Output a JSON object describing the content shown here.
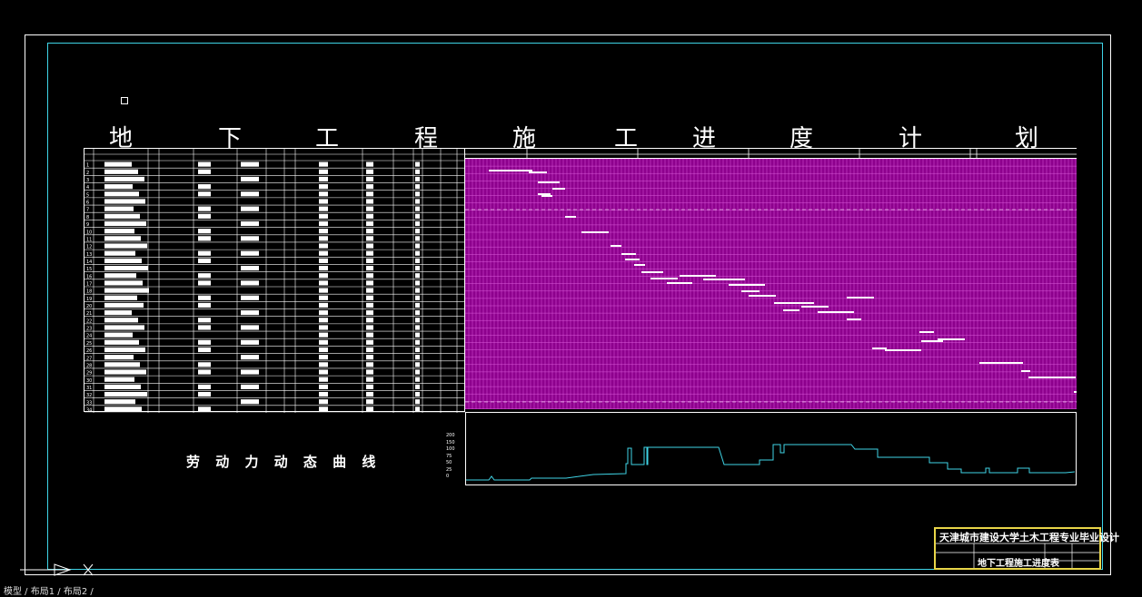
{
  "drawing": {
    "title_chars": [
      "地",
      "下",
      "工",
      "程",
      "施",
      "工",
      "进",
      "度",
      "计",
      "划"
    ],
    "labor_curve_label": "劳 动 力 动 态 曲 线",
    "title_block": {
      "school": "天津城市建设大学土木工程专业毕业设计",
      "drawing_name": "地下工程施工进度表"
    },
    "row_numbers": [
      "1",
      "2",
      "3",
      "4",
      "5",
      "6",
      "7",
      "8",
      "9",
      "10",
      "11",
      "12",
      "13",
      "14",
      "15",
      "16",
      "17",
      "18",
      "19",
      "20",
      "21",
      "22",
      "23",
      "24",
      "25",
      "26",
      "27",
      "28",
      "29",
      "30",
      "31",
      "32",
      "33",
      "34"
    ],
    "labor_axis_ticks": [
      "200",
      "150",
      "100",
      "75",
      "50",
      "25",
      "0"
    ],
    "colors": {
      "gantt_bg": "#8d008d",
      "frame": "#ffffff",
      "inner_frame": "#3fd4e6",
      "curve": "#3fd4e6",
      "title_block_border": "#e8d548"
    }
  },
  "status_bar": {
    "tabs": "模型 / 布局1 / 布局2 /"
  }
}
